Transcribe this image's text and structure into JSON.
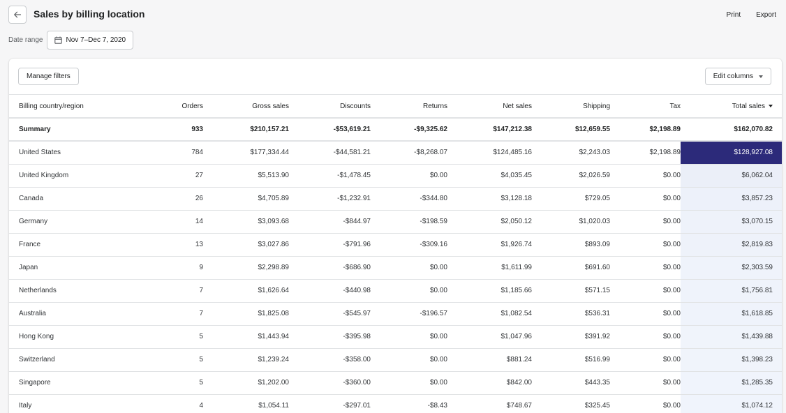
{
  "header": {
    "back_icon": "arrow-left-icon",
    "title": "Sales by billing location",
    "print_label": "Print",
    "export_label": "Export"
  },
  "date_range": {
    "label": "Date range",
    "value": "Nov 7–Dec 7, 2020",
    "icon": "calendar-icon"
  },
  "toolbar": {
    "manage_filters": "Manage filters",
    "edit_columns": "Edit columns"
  },
  "columns": [
    "Billing country/region",
    "Orders",
    "Gross sales",
    "Discounts",
    "Returns",
    "Net sales",
    "Shipping",
    "Tax",
    "Total sales"
  ],
  "summary": [
    "Summary",
    "933",
    "$210,157.21",
    "-$53,619.21",
    "-$9,325.62",
    "$147,212.38",
    "$12,659.55",
    "$2,198.89",
    "$162,070.82"
  ],
  "rows": [
    [
      "United States",
      "784",
      "$177,334.44",
      "-$44,581.21",
      "-$8,268.07",
      "$124,485.16",
      "$2,243.03",
      "$2,198.89",
      "$128,927.08"
    ],
    [
      "United Kingdom",
      "27",
      "$5,513.90",
      "-$1,478.45",
      "$0.00",
      "$4,035.45",
      "$2,026.59",
      "$0.00",
      "$6,062.04"
    ],
    [
      "Canada",
      "26",
      "$4,705.89",
      "-$1,232.91",
      "-$344.80",
      "$3,128.18",
      "$729.05",
      "$0.00",
      "$3,857.23"
    ],
    [
      "Germany",
      "14",
      "$3,093.68",
      "-$844.97",
      "-$198.59",
      "$2,050.12",
      "$1,020.03",
      "$0.00",
      "$3,070.15"
    ],
    [
      "France",
      "13",
      "$3,027.86",
      "-$791.96",
      "-$309.16",
      "$1,926.74",
      "$893.09",
      "$0.00",
      "$2,819.83"
    ],
    [
      "Japan",
      "9",
      "$2,298.89",
      "-$686.90",
      "$0.00",
      "$1,611.99",
      "$691.60",
      "$0.00",
      "$2,303.59"
    ],
    [
      "Netherlands",
      "7",
      "$1,626.64",
      "-$440.98",
      "$0.00",
      "$1,185.66",
      "$571.15",
      "$0.00",
      "$1,756.81"
    ],
    [
      "Australia",
      "7",
      "$1,825.08",
      "-$545.97",
      "-$196.57",
      "$1,082.54",
      "$536.31",
      "$0.00",
      "$1,618.85"
    ],
    [
      "Hong Kong",
      "5",
      "$1,443.94",
      "-$395.98",
      "$0.00",
      "$1,047.96",
      "$391.92",
      "$0.00",
      "$1,439.88"
    ],
    [
      "Switzerland",
      "5",
      "$1,239.24",
      "-$358.00",
      "$0.00",
      "$881.24",
      "$516.99",
      "$0.00",
      "$1,398.23"
    ],
    [
      "Singapore",
      "5",
      "$1,202.00",
      "-$360.00",
      "$0.00",
      "$842.00",
      "$443.35",
      "$0.00",
      "$1,285.35"
    ],
    [
      "Italy",
      "4",
      "$1,054.11",
      "-$297.01",
      "-$8.43",
      "$748.67",
      "$325.45",
      "$0.00",
      "$1,074.12"
    ]
  ],
  "heat": {
    "max_color": "#2c2a7a",
    "min_color": "#f2f6fd",
    "max_text": "#ffffff"
  }
}
